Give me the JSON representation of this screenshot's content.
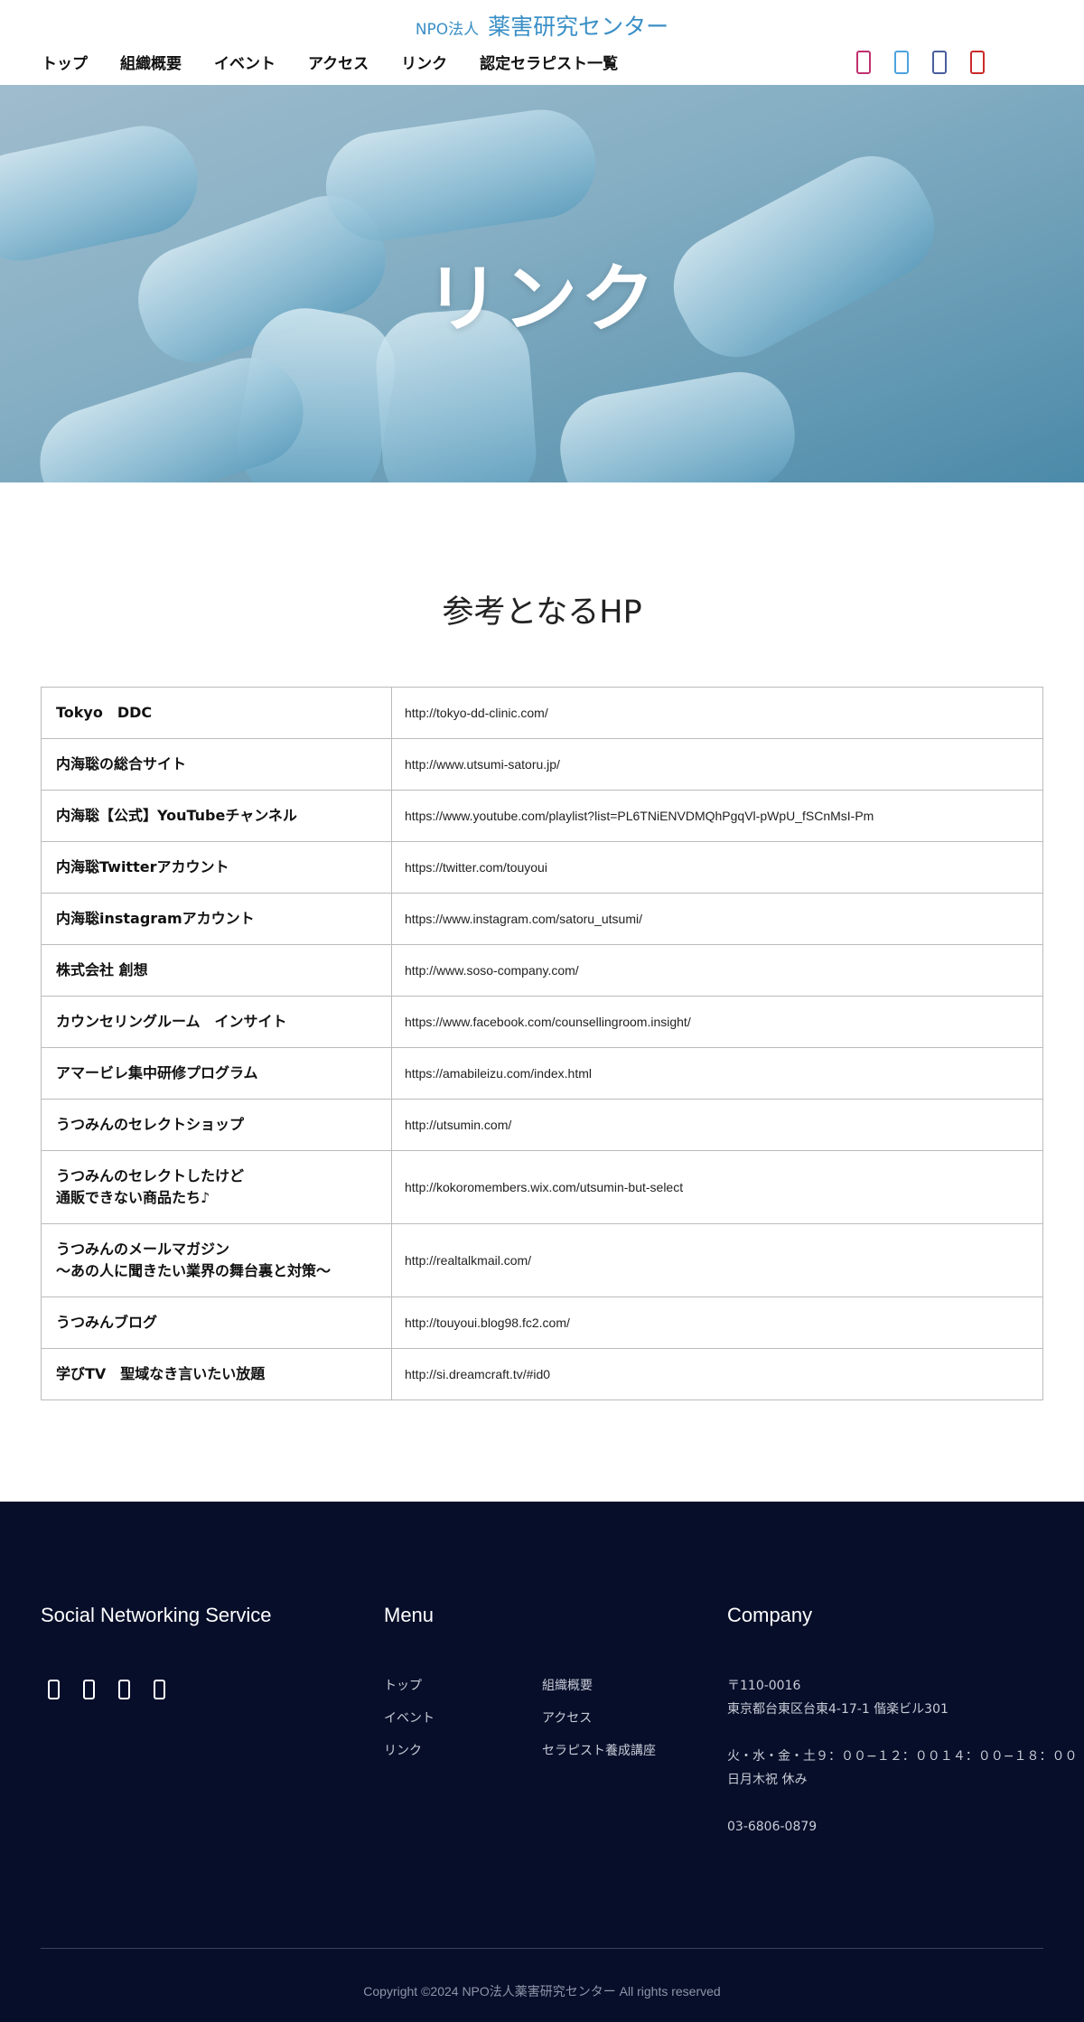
{
  "header": {
    "logo_small": "NPO法人",
    "logo_big": "薬害研究センター",
    "nav": [
      {
        "label": "トップ"
      },
      {
        "label": "組織概要"
      },
      {
        "label": "イベント"
      },
      {
        "label": "アクセス"
      },
      {
        "label": "リンク"
      },
      {
        "label": "認定セラピスト一覧"
      }
    ],
    "sns_icons": [
      "instagram-icon",
      "twitter-icon",
      "facebook-icon",
      "youtube-icon"
    ]
  },
  "hero": {
    "title": "リンク"
  },
  "links_section": {
    "title": "参考となるHP",
    "rows": [
      {
        "name": "Tokyo　DDC",
        "url": "http://tokyo-dd-clinic.com/"
      },
      {
        "name": "内海聡の総合サイト",
        "url": "http://www.utsumi-satoru.jp/"
      },
      {
        "name": "内海聡【公式】YouTubeチャンネル",
        "url": "https://www.youtube.com/playlist?list=PL6TNiENVDMQhPgqVl-pWpU_fSCnMsI-Pm"
      },
      {
        "name": "内海聡Twitterアカウント",
        "url": "https://twitter.com/touyoui"
      },
      {
        "name": "内海聡instagramアカウント",
        "url": "https://www.instagram.com/satoru_utsumi/"
      },
      {
        "name": "株式会社 創想",
        "url": "http://www.soso-company.com/"
      },
      {
        "name": "カウンセリングルーム　インサイト",
        "url": "https://www.facebook.com/counsellingroom.insight/"
      },
      {
        "name": "アマービレ集中研修プログラム",
        "url": "https://amabileizu.com/index.html"
      },
      {
        "name": "うつみんのセレクトショップ",
        "url": "http://utsumin.com/"
      },
      {
        "name": "うつみんのセレクトしたけど",
        "name2": "通販できない商品たち♪",
        "url": "http://kokoromembers.wix.com/utsumin-but-select"
      },
      {
        "name": "うつみんのメールマガジン",
        "name2": "〜あの人に聞きたい業界の舞台裏と対策〜",
        "url": "http://realtalkmail.com/"
      },
      {
        "name": "うつみんブログ",
        "url": "http://touyoui.blog98.fc2.com/"
      },
      {
        "name": "学びTV　聖域なき言いたい放題",
        "url": "http://si.dreamcraft.tv/#id0"
      }
    ]
  },
  "footer": {
    "sns_title": "Social Networking Service",
    "menu_title": "Menu",
    "menu": [
      {
        "label": "トップ"
      },
      {
        "label": "組織概要"
      },
      {
        "label": "イベント"
      },
      {
        "label": "アクセス"
      },
      {
        "label": "リンク"
      },
      {
        "label": "セラピスト養成講座"
      }
    ],
    "company_title": "Company",
    "postal": "〒110-0016",
    "address": "東京都台東区台東4-17-1 偕楽ビル301",
    "hours": "火・水・金・土９：００−１２：００１４：００−１８：００",
    "closed": "日月木祝 休み",
    "phone": "03-6806-0879",
    "copyright": "Copyright ©2024 NPO法人薬害研究センター All rights reserved"
  }
}
